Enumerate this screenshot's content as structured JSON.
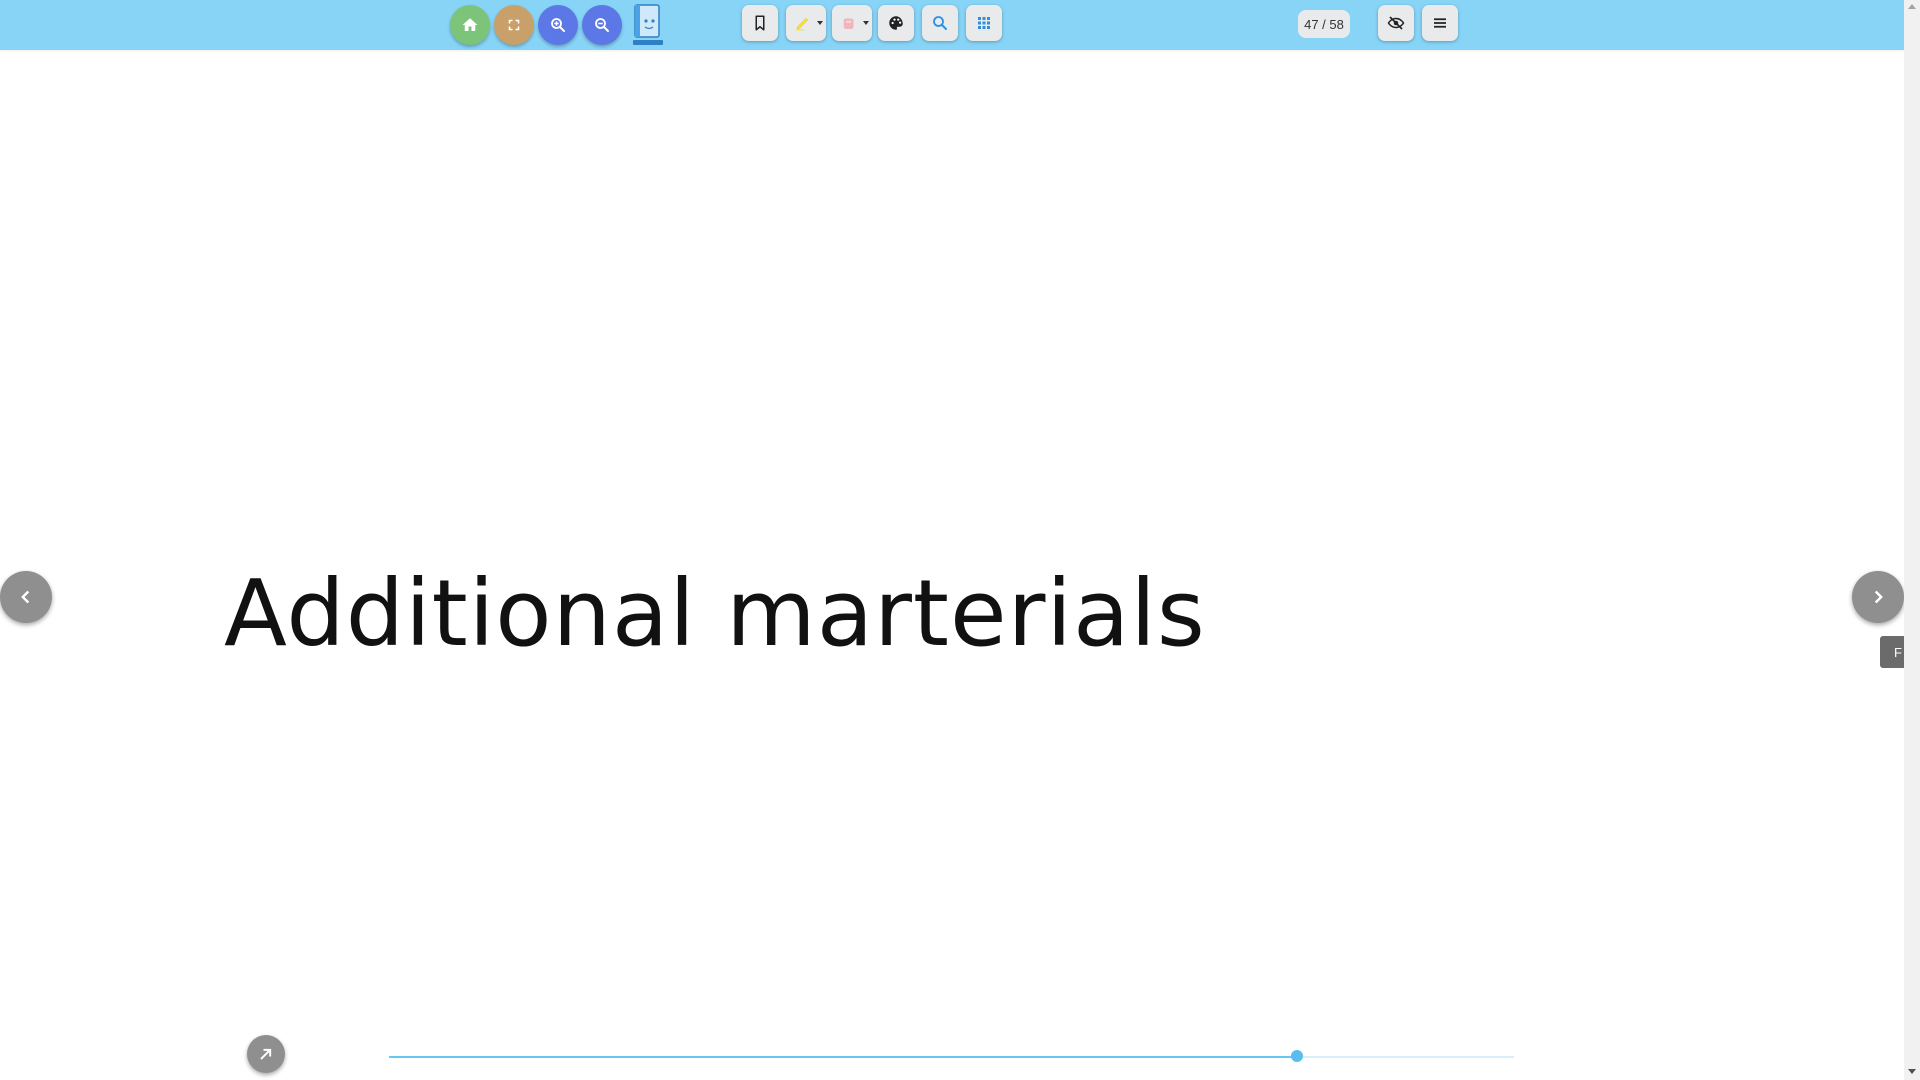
{
  "toolbar": {
    "bg_color": "#87d4f7",
    "left_buttons": [
      {
        "name": "home-button",
        "icon": "home-icon",
        "color": "#7cc47a"
      },
      {
        "name": "fullscreen-button",
        "icon": "fullscreen-icon",
        "color": "#c9a06a"
      },
      {
        "name": "zoom-in-button",
        "icon": "zoom-in-icon",
        "color": "#5b78e6"
      },
      {
        "name": "zoom-out-button",
        "icon": "zoom-out-icon",
        "color": "#5b78e6"
      }
    ],
    "tool_buttons": [
      {
        "name": "bookmark-button",
        "icon": "bookmark-icon"
      },
      {
        "name": "highlighter-button",
        "icon": "highlighter-icon",
        "color": "#f7e44a"
      },
      {
        "name": "eraser-button",
        "icon": "eraser-icon",
        "color": "#f3b3bd"
      },
      {
        "name": "palette-button",
        "icon": "palette-icon"
      },
      {
        "name": "search-button",
        "icon": "search-icon",
        "color": "#2f8fe0"
      },
      {
        "name": "grid-view-button",
        "icon": "grid-icon",
        "color": "#2f8fe0"
      }
    ],
    "page_counter": "47 / 58",
    "right_buttons": [
      {
        "name": "hide-toolbar-button",
        "icon": "eye-off-icon"
      },
      {
        "name": "menu-button",
        "icon": "hamburger-menu-icon"
      }
    ]
  },
  "slide": {
    "title": "Additional marterials"
  },
  "side_tab": {
    "label": "F"
  },
  "progress": {
    "current_page": 47,
    "total_pages": 58,
    "fraction": 0.807,
    "accent_color": "#5bbdee"
  }
}
